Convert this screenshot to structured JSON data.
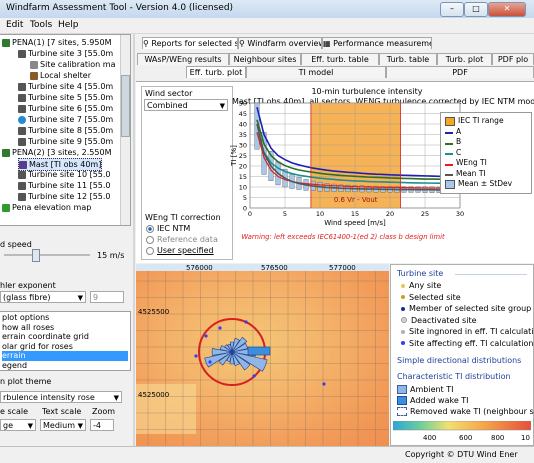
{
  "window": {
    "title": "Windfarm Assessment Tool - Version 4.0 (licensed)",
    "min": "–",
    "max": "□",
    "close": "✕"
  },
  "menu": [
    "Edit",
    "Tools",
    "Help"
  ],
  "tree": [
    {
      "label": "PENA(1) [7 sites, 5.950M",
      "kind": "group"
    },
    {
      "label": "Turbine site 3 [55.0m",
      "kind": "turbine"
    },
    {
      "label": "Site calibration ma",
      "kind": "calib"
    },
    {
      "label": "Local shelter",
      "kind": "shelter"
    },
    {
      "label": "Turbine site 4 [55.0m",
      "kind": "turbine"
    },
    {
      "label": "Turbine site 5 [55.0m",
      "kind": "turbine"
    },
    {
      "label": "Turbine site 6 [55.0m",
      "kind": "turbine"
    },
    {
      "label": "Turbine site 7 [55.0m",
      "kind": "turbine-sel"
    },
    {
      "label": "Turbine site 8 [55.0m",
      "kind": "turbine"
    },
    {
      "label": "Turbine site 9 [55.0m",
      "kind": "turbine"
    },
    {
      "label": "PENA(2) [3 sites, 2.550M",
      "kind": "group"
    },
    {
      "label": "Mast [TI obs 40m]",
      "kind": "mast"
    },
    {
      "label": "Turbine site 10 [55.0",
      "kind": "turbine"
    },
    {
      "label": "Turbine site 11 [55.0",
      "kind": "turbine"
    },
    {
      "label": "Turbine site 12 [55.0",
      "kind": "turbine"
    },
    {
      "label": "Pena elevation map",
      "kind": "map"
    }
  ],
  "left_controls": {
    "wind_speed_label": "d speed",
    "wind_speed_value": "15 m/s",
    "hellmann_label": "hler exponent",
    "hellmann_combo": "(glass fibre)",
    "hellmann_spin": "9",
    "options": [
      "plot options",
      "how all roses",
      "errain coordinate grid",
      "olar grid for roses",
      "errain",
      "egend"
    ],
    "selected_option_index": 4,
    "theme_label": "n plot theme",
    "theme_combo": "rbulence intensity rose",
    "scale_label": "e scale",
    "text_scale_label": "Text scale",
    "zoom_label": "Zoom",
    "scale_combo": "ge",
    "text_scale_combo": "Medium",
    "zoom_spin": "-4"
  },
  "tabs_row1": [
    "Reports for selected site",
    "Windfarm overview",
    "Performance measurements"
  ],
  "tabs_row2": [
    "WAsP/WEng results",
    "Neighbour sites",
    "Eff. turb. table",
    "Turb. table",
    "Turb. plot",
    "PDF plo"
  ],
  "tabs_row3": [
    "Eff. turb. plot",
    "TI model",
    "PDF"
  ],
  "wind_sector": {
    "title": "Wind sector",
    "combo": "Combined",
    "correction_title": "WEng TI correction",
    "options": [
      "IEC NTM",
      "Reference data",
      "User specified"
    ],
    "selected": 0
  },
  "chart_data": {
    "type": "line",
    "title": "10-min turbulence intensity",
    "subtitle": "Mast [TI obs 40m], all sectors, WENG turbulence corrected by IEC NTM model",
    "xlabel": "Wind speed [m/s]",
    "ylabel": "TI [%]",
    "xlim": [
      0,
      30
    ],
    "ylim": [
      0,
      50
    ],
    "xticks": [
      0,
      5,
      10,
      15,
      20,
      25,
      30
    ],
    "yticks": [
      0,
      5,
      10,
      15,
      20,
      25,
      30,
      35,
      40,
      45,
      50
    ],
    "shaded_range": [
      8.7,
      21.5
    ],
    "shaded_label": "0.6 Vr - Vout",
    "warning": "Warning: left exceeds IEC61400-1(ed 2) class b design limit",
    "x": [
      1,
      2,
      3,
      4,
      5,
      6,
      7,
      8,
      9,
      10,
      11,
      12,
      13,
      14,
      15,
      16,
      17,
      18,
      19,
      20,
      21,
      22,
      23,
      24,
      25,
      26,
      27,
      28,
      29,
      30
    ],
    "series": [
      {
        "name": "A",
        "color": "#1f1fb0",
        "values": [
          48,
          35,
          28.5,
          25,
          23,
          21.5,
          20.5,
          19.7,
          19,
          18.5,
          18,
          17.6,
          17.3,
          17,
          16.8,
          16.5,
          16.3,
          16.1,
          16,
          15.8,
          15.7,
          15.6,
          15.5,
          15.4,
          15.3,
          15.2,
          15.1,
          15.05,
          15,
          14.9
        ]
      },
      {
        "name": "B",
        "color": "#2a6f2a",
        "values": [
          42,
          30.5,
          25,
          22,
          20.2,
          19,
          18.1,
          17.5,
          17,
          16.5,
          16.1,
          15.8,
          15.5,
          15.3,
          15.1,
          14.9,
          14.7,
          14.6,
          14.5,
          14.3,
          14.2,
          14.1,
          14,
          13.9,
          13.8,
          13.8,
          13.7,
          13.6,
          13.6,
          13.5
        ]
      },
      {
        "name": "C",
        "color": "#1e8e8e",
        "values": [
          36,
          26.5,
          21.5,
          19,
          17.4,
          16.4,
          15.6,
          15.1,
          14.6,
          14.2,
          13.9,
          13.6,
          13.3,
          13.1,
          12.9,
          12.8,
          12.6,
          12.5,
          12.4,
          12.3,
          12.2,
          12.1,
          12,
          11.95,
          11.9,
          11.85,
          11.8,
          11.75,
          11.7,
          11.6
        ]
      },
      {
        "name": "WEng TI",
        "color": "#e02020",
        "values": [
          36,
          24,
          18,
          15,
          13.5,
          12.6,
          12,
          11.6,
          11.3,
          11,
          10.8,
          10.6,
          10.5,
          10.3,
          10.2,
          10.1,
          10,
          9.9,
          9.85,
          9.8,
          9.75,
          9.7,
          9.65,
          9.6,
          9.55,
          9.5,
          9.5,
          9.45,
          9.4,
          9.4
        ]
      },
      {
        "name": "Mean TI",
        "color": "#555555",
        "values": [
          40,
          26,
          20,
          16.5,
          14.2,
          12.6,
          11.7,
          11,
          10.5,
          10.1,
          9.8,
          9.6,
          9.4,
          9.3,
          9.2,
          9.1,
          9,
          9,
          8.9,
          8.9,
          8.8,
          8.8,
          8.8,
          8.7,
          8.7,
          8.7,
          8.6,
          8.6,
          8.6,
          8.5
        ]
      }
    ],
    "stdev_boxes": {
      "name": "Mean ± StDev",
      "x": [
        1,
        2,
        3,
        4,
        5,
        6,
        7,
        8,
        9,
        10,
        11,
        12,
        13,
        14,
        15,
        16,
        17,
        18,
        19,
        20,
        21,
        22,
        23,
        24,
        25,
        26,
        27
      ],
      "low": [
        28,
        16,
        13,
        11,
        10,
        9.3,
        8.8,
        8.4,
        8.2,
        8,
        7.9,
        7.8,
        7.8,
        7.7,
        7.7,
        7.6,
        7.6,
        7.5,
        7.5,
        7.5,
        7.4,
        7.4,
        7.4,
        7.4,
        7.3,
        7.3,
        7.3
      ],
      "high": [
        50,
        36,
        27,
        22,
        18.5,
        16,
        14.6,
        13.6,
        12.8,
        12.2,
        11.7,
        11.4,
        11,
        10.9,
        10.7,
        10.6,
        10.4,
        10.4,
        10.3,
        10.3,
        10.2,
        10.2,
        10.2,
        10.1,
        10.1,
        10.1,
        10
      ]
    },
    "legend": [
      "IEC TI range",
      "A",
      "B",
      "C",
      "WEng TI",
      "Mean TI",
      "Mean ± StDev"
    ],
    "legend_colors": [
      "#f5a623",
      "#1f1fb0",
      "#2a6f2a",
      "#1e8e8e",
      "#e02020",
      "#555555",
      "#a5c8ea"
    ]
  },
  "map": {
    "x_labels": [
      "576000",
      "576500",
      "577000"
    ],
    "y_labels": [
      "4525500",
      "4525000"
    ],
    "colorbar_ticks": [
      "400",
      "600",
      "800",
      "10"
    ]
  },
  "right_panel": {
    "turbine_site_header": "Turbine site",
    "turbine_items": [
      "Any site",
      "Selected site",
      "Member of selected site group",
      "Deactivated site",
      "Site ingnored in eff. TI calculation",
      "Site affecting eff. TI calculation"
    ],
    "turbine_colors": [
      "#e8c84a",
      "#c9a01e",
      "#1e2a8e",
      "#d6d6d6",
      "#b0b0b0",
      "#3a3af0"
    ],
    "simple_header": "Simple directional distributions",
    "char_header": "Characteristic TI distribution",
    "char_items": [
      "Ambient TI",
      "Added wake TI",
      "Removed wake TI (neighbour shut)"
    ]
  },
  "status": {
    "copyright": "Copyright ©  DTU Wind Ener"
  }
}
